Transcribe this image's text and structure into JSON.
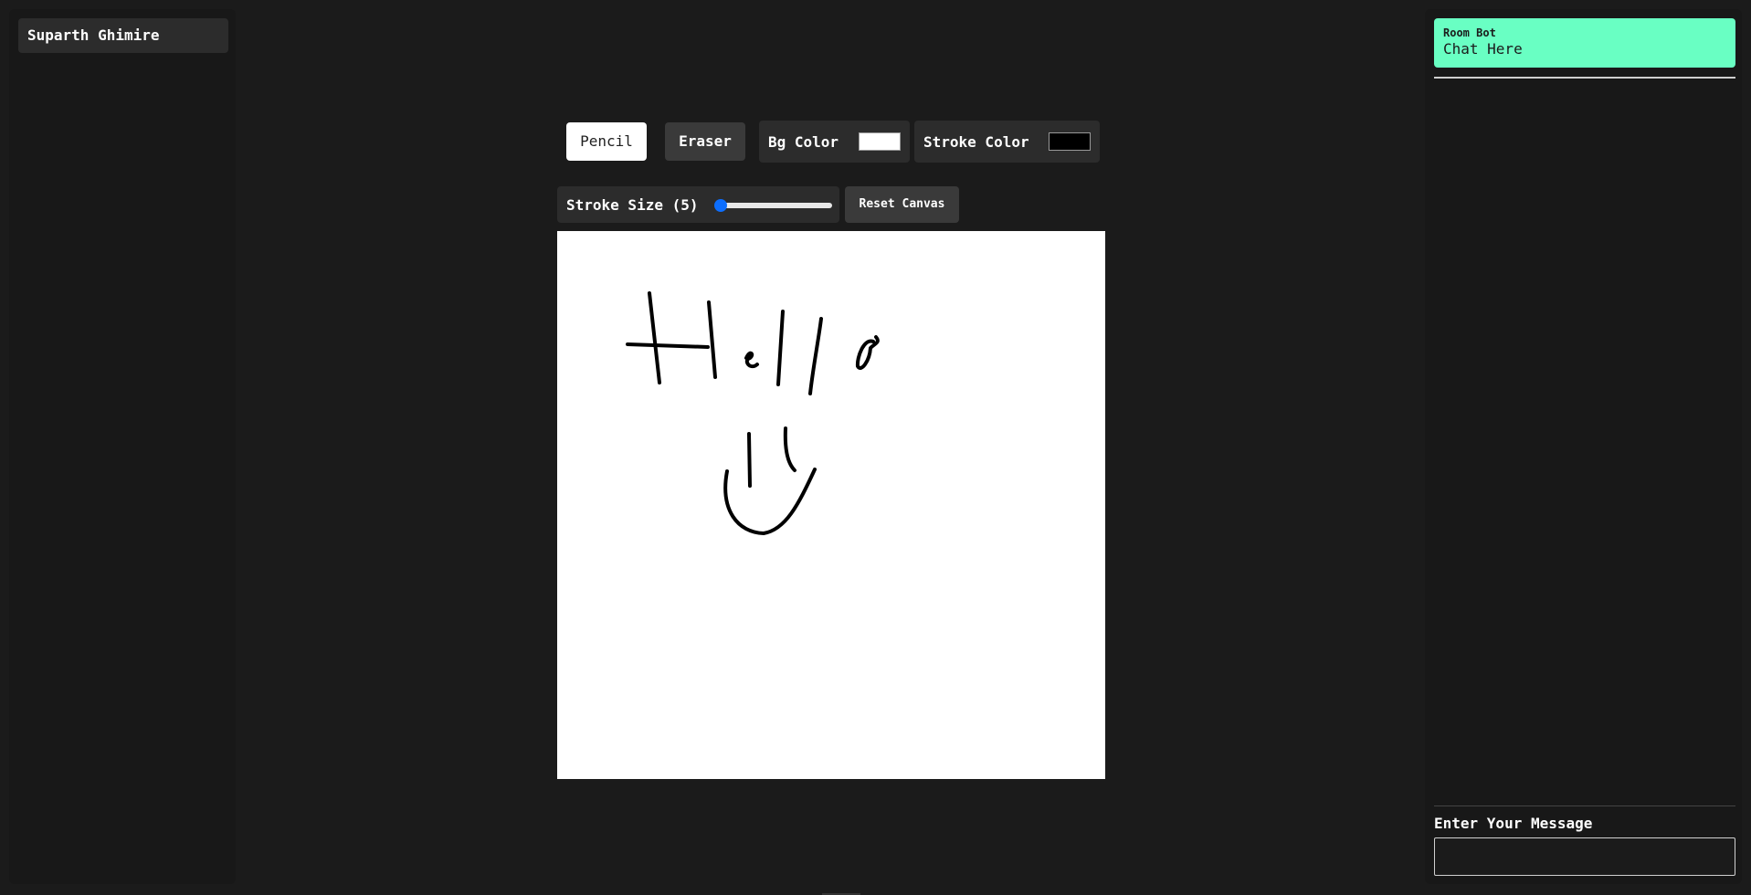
{
  "users": [
    {
      "name": "Suparth Ghimire"
    }
  ],
  "toolbar": {
    "pencil_label": "Pencil",
    "eraser_label": "Eraser",
    "bg_color_label": "Bg Color",
    "bg_color_value": "#ffffff",
    "stroke_color_label": "Stroke Color",
    "stroke_color_value": "#000000",
    "stroke_size_label": "Stroke Size (5)",
    "stroke_size_value": 5,
    "stroke_size_fraction": 0.05,
    "reset_label": "Reset Canvas"
  },
  "chat": {
    "messages": [
      {
        "sender": "Room Bot",
        "text": "Chat Here"
      }
    ],
    "input_label": "Enter Your Message",
    "input_value": ""
  },
  "colors": {
    "bot_bubble": "#69ffc3",
    "accent": "#0d6efd",
    "background": "#1b1b1b"
  }
}
